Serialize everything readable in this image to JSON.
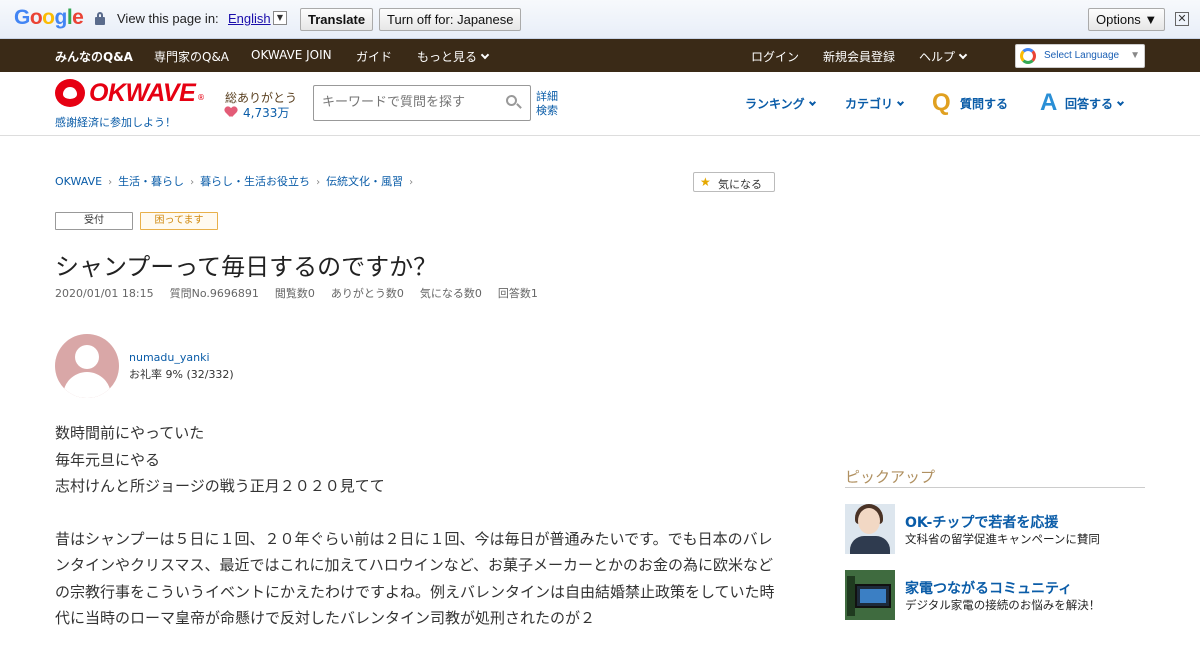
{
  "translate_bar": {
    "logo": "Google",
    "view_text": "View this page in:",
    "language": "English",
    "translate_label": "Translate",
    "turn_off_label": "Turn off for: Japanese",
    "options_label": "Options ▼",
    "close": "✕"
  },
  "topnav": {
    "items": [
      "みんなのQ&A",
      "専門家のQ&A",
      "OKWAVE JOIN",
      "ガイド",
      "もっと見る"
    ],
    "right": [
      "ログイン",
      "新規会員登録",
      "ヘルプ"
    ],
    "select_language": "Select Language",
    "select_arrow": "▼"
  },
  "header": {
    "logo_text": "OKWAVE",
    "logo_reg": "®",
    "tagline": "感謝経済に参加しよう！",
    "thanks_label": "総ありがとう",
    "thanks_count": "4,733万",
    "search_placeholder": "キーワードで質問を探す",
    "advanced_search": "詳細検索",
    "nav": [
      "ランキング",
      "カテゴリ"
    ],
    "ask_letter": "Q",
    "ask_label": "質問する",
    "answer_letter": "A",
    "answer_label": "回答する"
  },
  "breadcrumb": [
    "OKWAVE",
    "生活・暮らし",
    "暮らし・生活お役立ち",
    "伝統文化・風習"
  ],
  "breadcrumb_sep": "›",
  "watch_label": "気になる",
  "watch_icon": "★",
  "tags": {
    "status": "受付",
    "state": "困ってます"
  },
  "question": {
    "title": "シャンプーって毎日するのですか？",
    "date": "2020/01/01 18:15",
    "number": "質問No.9696891",
    "views": "閲覧数0",
    "thanks": "ありがとう数0",
    "watching": "気になる数0",
    "answers": "回答数1"
  },
  "user": {
    "name": "numadu_yanki",
    "rate": "お礼率 9%  (32/332)"
  },
  "body": {
    "p1_l1": "数時間前にやっていた",
    "p1_l2": "毎年元旦にやる",
    "p1_l3": "志村けんと所ジョージの戦う正月２０２０見てて",
    "p2": "昔はシャンプーは５日に１回、２０年ぐらい前は２日に１回、今は毎日が普通みたいです。でも日本のバレンタインやクリスマス、最近ではこれに加えてハロウインなど、お菓子メーカーとかのお金の為に欧米などの宗教行事をこういうイベントにかえたわけですよね。例えバレンタインは自由結婚禁止政策をしていた時代に当時のローマ皇帝が命懸けで反対したバレンタイン司教が処刑されたのが２"
  },
  "sidebar": {
    "pickup_title": "ピックアップ",
    "items": [
      {
        "title": "OK-チップで若者を応援",
        "desc": "文科省の留学促進キャンペーンに賛同"
      },
      {
        "title": "家電つながるコミュニティ",
        "desc": "デジタル家電の接続のお悩みを解決！"
      }
    ]
  }
}
